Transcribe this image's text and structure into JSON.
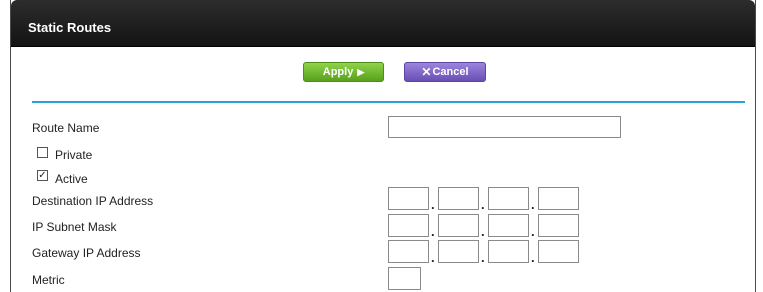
{
  "panel": {
    "title": "Static Routes"
  },
  "actions": {
    "apply_label": "Apply",
    "apply_glyph": "▶",
    "cancel_label": "Cancel",
    "cancel_glyph": "✕"
  },
  "form": {
    "route_name": {
      "label": "Route Name",
      "value": ""
    },
    "private": {
      "label": "Private",
      "checked": false
    },
    "active": {
      "label": "Active",
      "checked": true,
      "mark": "✓"
    },
    "destination_ip": {
      "label": "Destination IP Address",
      "octets": [
        "",
        "",
        "",
        ""
      ],
      "separator": "."
    },
    "subnet_mask": {
      "label": "IP Subnet Mask",
      "octets": [
        "",
        "",
        "",
        ""
      ],
      "separator": "."
    },
    "gateway_ip": {
      "label": "Gateway IP Address",
      "octets": [
        "",
        "",
        "",
        ""
      ],
      "separator": "."
    },
    "metric": {
      "label": "Metric",
      "value": ""
    }
  },
  "colors": {
    "title_bar": "#1f1f1f",
    "apply_button": "#6bb62a",
    "cancel_button": "#7b5fc4",
    "divider": "#27a3d8"
  }
}
